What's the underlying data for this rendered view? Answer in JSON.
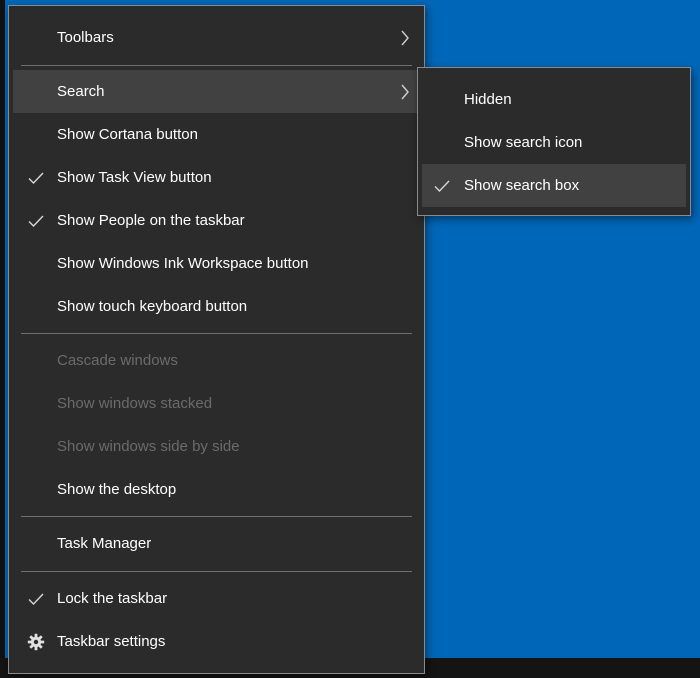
{
  "main_menu": {
    "toolbars": "Toolbars",
    "search": "Search",
    "show_cortana": "Show Cortana button",
    "show_task_view": "Show Task View button",
    "show_people": "Show People on the taskbar",
    "show_ink_workspace": "Show Windows Ink Workspace button",
    "show_touch_keyboard": "Show touch keyboard button",
    "cascade_windows": "Cascade windows",
    "show_stacked": "Show windows stacked",
    "show_side_by_side": "Show windows side by side",
    "show_desktop": "Show the desktop",
    "task_manager": "Task Manager",
    "lock_taskbar": "Lock the taskbar",
    "taskbar_settings": "Taskbar settings"
  },
  "checked_items": [
    "Show Task View button",
    "Show People on the taskbar",
    "Lock the taskbar",
    "Show search box"
  ],
  "disabled_items": [
    "Cascade windows",
    "Show windows stacked",
    "Show windows side by side"
  ],
  "highlighted_item": "Search",
  "search_submenu": {
    "hidden": "Hidden",
    "show_search_icon": "Show search icon",
    "show_search_box": "Show search box",
    "selected": "Show search box"
  },
  "icons": {
    "check": "checkmark-icon",
    "submenu_arrow": "chevron-right-icon",
    "settings": "gear-icon"
  },
  "colors": {
    "desktop": "#0067b8",
    "menu_bg": "#2b2b2b",
    "highlight": "#414141",
    "text": "#ffffff",
    "disabled_text": "#6b6b6b"
  }
}
